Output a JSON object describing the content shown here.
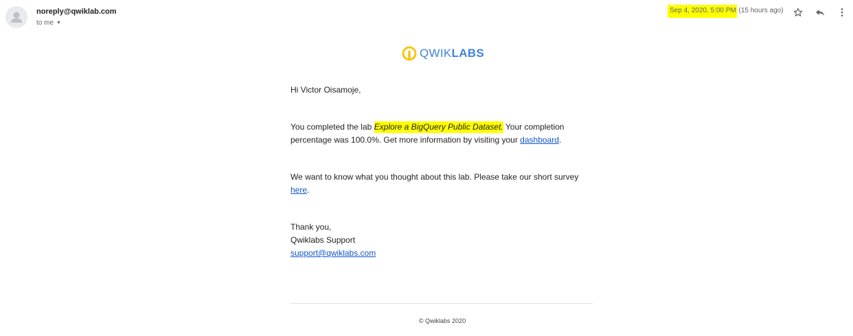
{
  "sender": {
    "email": "noreply@qwiklab.com",
    "to": "to me"
  },
  "header": {
    "date": "Sep 4, 2020, 5:00 PM",
    "relative": "(15 hours ago)"
  },
  "icons": {
    "avatar": "person-icon",
    "caret": "chevron-down-icon",
    "star": "star-icon",
    "reply": "reply-icon",
    "more": "more-vertical-icon"
  },
  "logo": {
    "qwik": "QWIK",
    "labs": "LABS",
    "brand_yellow": "#f6c614",
    "brand_blue": "#3f83d8"
  },
  "email": {
    "greeting": "Hi Victor Oisamoje,",
    "p1_pre": "You completed the lab ",
    "lab_name": "Explore a BigQuery Public Dataset.",
    "p1_mid": " Your completion percentage was 100.0%. Get more information by visiting your ",
    "dashboard_link": "dashboard",
    "p1_end": ".",
    "p2_pre": "We want to know what you thought about this lab. Please take our short survey ",
    "survey_link": "here",
    "p2_end": ".",
    "sign_thanks": "Thank you,",
    "sign_team": "Qwiklabs Support",
    "support_email": "support@qwiklabs.com"
  },
  "footer": {
    "copyright": "© Qwiklabs 2020"
  },
  "colors": {
    "highlight": "#ffff00",
    "link": "#1155cc"
  }
}
